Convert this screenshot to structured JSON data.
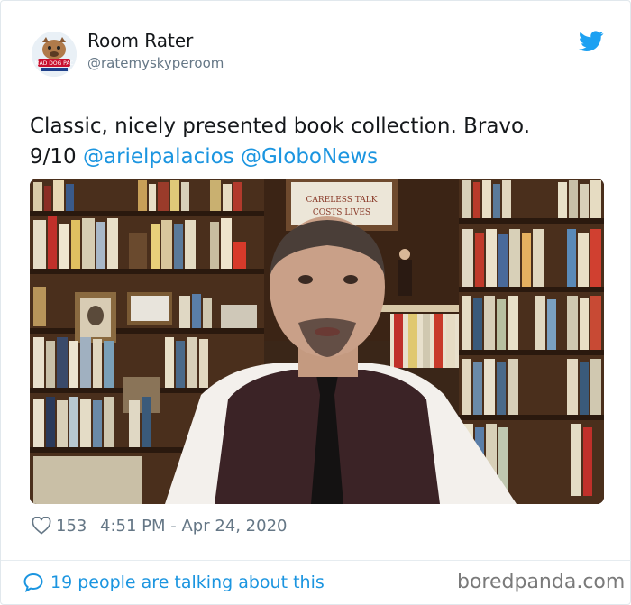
{
  "user": {
    "display_name": "Room Rater",
    "handle": "@ratemyskyperoom",
    "avatar_icon": "bulldog-mascot-logo-icon",
    "avatar_logo_text": "MAD DOG PAC"
  },
  "tweet": {
    "text_part1": "Classic, nicely presented book collection. Bravo.",
    "text_part2": "9/10 ",
    "mention_1": "@arielpalacios",
    "mention_2": "@GloboNews"
  },
  "media": {
    "sign_text": "CARELESS TALK COSTS LIVES"
  },
  "stats": {
    "like_count": "153",
    "timestamp": "4:51 PM - Apr 24, 2020"
  },
  "footer": {
    "talking_text": "19 people are talking about this",
    "watermark": "boredpanda.com"
  },
  "colors": {
    "link_blue": "#1b95e0",
    "twitter_blue": "#1da1f2",
    "muted_gray": "#657786"
  },
  "icons": {
    "brand": "twitter-bird-icon",
    "like": "heart-icon",
    "reply": "speech-bubble-icon"
  }
}
